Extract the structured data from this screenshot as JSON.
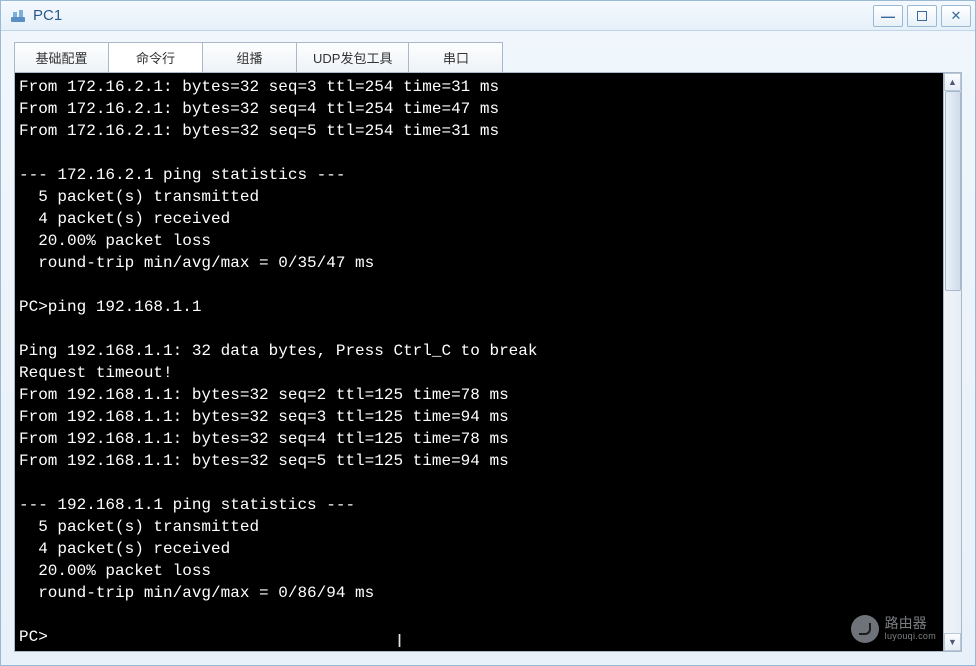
{
  "window": {
    "title": "PC1"
  },
  "tabs": [
    {
      "label": "基础配置",
      "active": false
    },
    {
      "label": "命令行",
      "active": true
    },
    {
      "label": "组播",
      "active": false
    },
    {
      "label": "UDP发包工具",
      "active": false
    },
    {
      "label": "串口",
      "active": false
    }
  ],
  "terminal": {
    "lines": [
      "From 172.16.2.1: bytes=32 seq=3 ttl=254 time=31 ms",
      "From 172.16.2.1: bytes=32 seq=4 ttl=254 time=47 ms",
      "From 172.16.2.1: bytes=32 seq=5 ttl=254 time=31 ms",
      "",
      "--- 172.16.2.1 ping statistics ---",
      "  5 packet(s) transmitted",
      "  4 packet(s) received",
      "  20.00% packet loss",
      "  round-trip min/avg/max = 0/35/47 ms",
      "",
      "PC>ping 192.168.1.1",
      "",
      "Ping 192.168.1.1: 32 data bytes, Press Ctrl_C to break",
      "Request timeout!",
      "From 192.168.1.1: bytes=32 seq=2 ttl=125 time=78 ms",
      "From 192.168.1.1: bytes=32 seq=3 ttl=125 time=94 ms",
      "From 192.168.1.1: bytes=32 seq=4 ttl=125 time=78 ms",
      "From 192.168.1.1: bytes=32 seq=5 ttl=125 time=94 ms",
      "",
      "--- 192.168.1.1 ping statistics ---",
      "  5 packet(s) transmitted",
      "  4 packet(s) received",
      "  20.00% packet loss",
      "  round-trip min/avg/max = 0/86/94 ms",
      "",
      "PC>"
    ]
  },
  "watermark": {
    "line1": "路由器",
    "line2": "luyouqi.com"
  }
}
